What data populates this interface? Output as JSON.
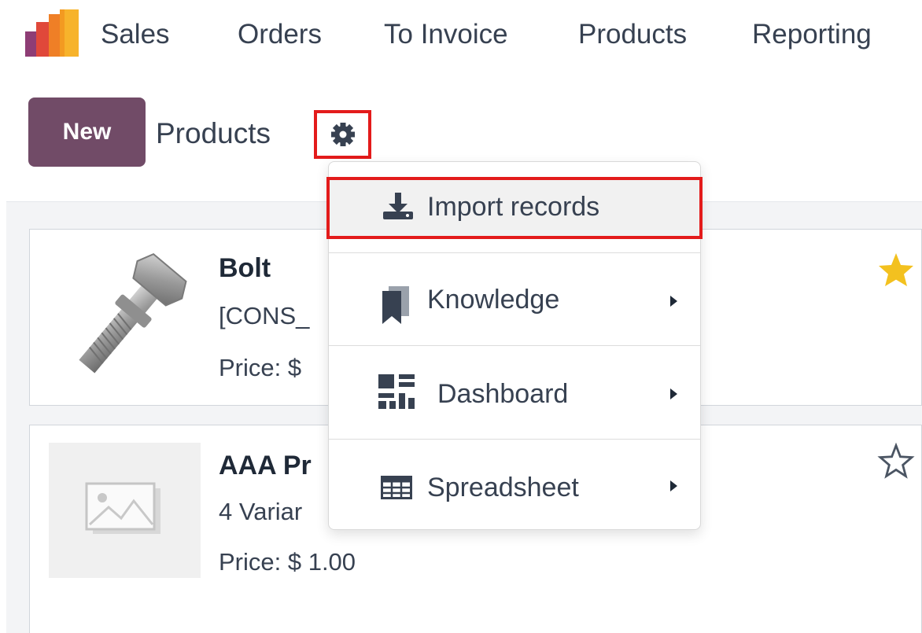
{
  "nav": {
    "app": "Sales",
    "items": [
      "Orders",
      "To Invoice",
      "Products",
      "Reporting"
    ]
  },
  "control": {
    "new_label": "New",
    "title": "Products"
  },
  "dropdown": {
    "items": [
      {
        "label": "Import records",
        "icon": "download-icon",
        "submenu": false
      },
      {
        "label": "Knowledge",
        "icon": "bookmark-icon",
        "submenu": true
      },
      {
        "label": "Dashboard",
        "icon": "dashboard-icon",
        "submenu": true
      },
      {
        "label": "Spreadsheet",
        "icon": "table-icon",
        "submenu": true
      }
    ]
  },
  "cards": [
    {
      "name": "Bolt",
      "subtitle": "[CONS_",
      "price": "Price: $",
      "favorite": true
    },
    {
      "name": "AAA Pr",
      "subtitle": "4 Variar",
      "price": "Price: $ 1.00",
      "favorite": false
    }
  ],
  "colors": {
    "brand": "#714B67",
    "highlight": "#e31b1b",
    "star": "#f3c11f"
  }
}
